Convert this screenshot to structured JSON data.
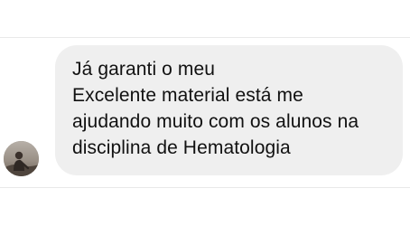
{
  "message": {
    "lines": [
      "Já garanti o meu",
      "Excelente material está me",
      "ajudando muito com os alunos na",
      "disciplina de Hematologia"
    ]
  },
  "avatar": {
    "icon": "profile-photo-icon"
  }
}
